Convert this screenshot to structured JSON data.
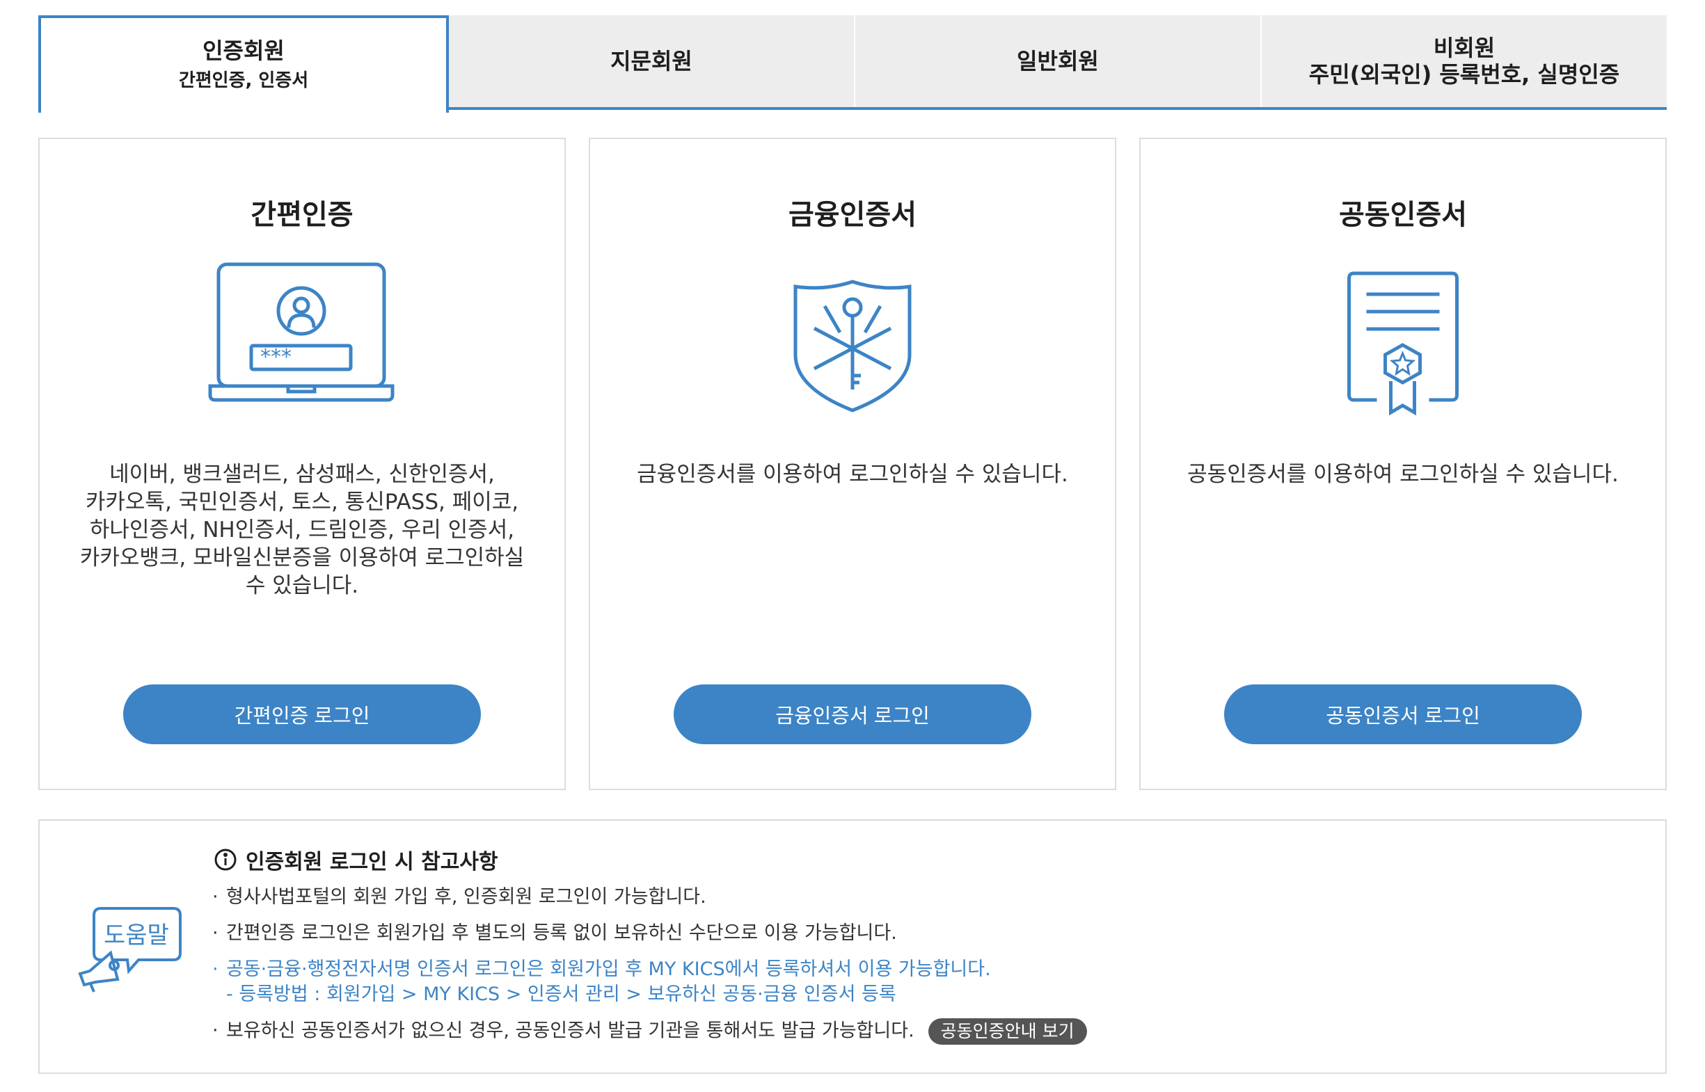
{
  "tabs": [
    {
      "label": "인증회원",
      "sub": "간편인증, 인증서"
    },
    {
      "label": "지문회원",
      "sub": ""
    },
    {
      "label": "일반회원",
      "sub": ""
    },
    {
      "label": "비회원",
      "sub": "주민(외국인) 등록번호, 실명인증"
    }
  ],
  "cards": [
    {
      "title": "간편인증",
      "icon": "laptop-login-icon",
      "desc": "네이버, 뱅크샐러드, 삼성패스, 신한인증서,\n카카오톡, 국민인증서, 토스, 통신PASS, 페이코,\n하나인증서, NH인증서, 드림인증, 우리 인증서,\n카카오뱅크, 모바일신분증을 이용하여 로그인하실\n수 있습니다.",
      "button": "간편인증 로그인",
      "icon_pw": "***"
    },
    {
      "title": "금융인증서",
      "icon": "shield-key-icon",
      "desc": "금융인증서를 이용하여 로그인하실 수 있습니다.",
      "button": "금융인증서 로그인"
    },
    {
      "title": "공동인증서",
      "icon": "certificate-icon",
      "desc": "공동인증서를 이용하여 로그인하실 수 있습니다.",
      "button": "공동인증서 로그인"
    }
  ],
  "notice": {
    "icon_label": "도움말",
    "title": "인증회원 로그인 시 참고사항",
    "items": [
      "형사사법포털의 회원 가입 후, 인증회원 로그인이 가능합니다.",
      "간편인증 로그인은 회원가입 후 별도의 등록 없이 보유하신 수단으로 이용 가능합니다.",
      "공동·금융·행정전자서명 인증서 로그인은 회원가입 후 MY KICS에서 등록하셔서 이용 가능합니다.",
      "보유하신 공동인증서가 없으신 경우, 공동인증서 발급 기관을 통해서도 발급 가능합니다."
    ],
    "sub_item": "- 등록방법 : 회원가입 > MY KICS > 인증서 관리 > 보유하신 공동·금융 인증서 등록",
    "badge": "공동인증안내 보기"
  },
  "colors": {
    "accent": "#3d84c6",
    "tab_bg": "#ededed",
    "border": "#dcdcdc",
    "badge": "#555555"
  }
}
